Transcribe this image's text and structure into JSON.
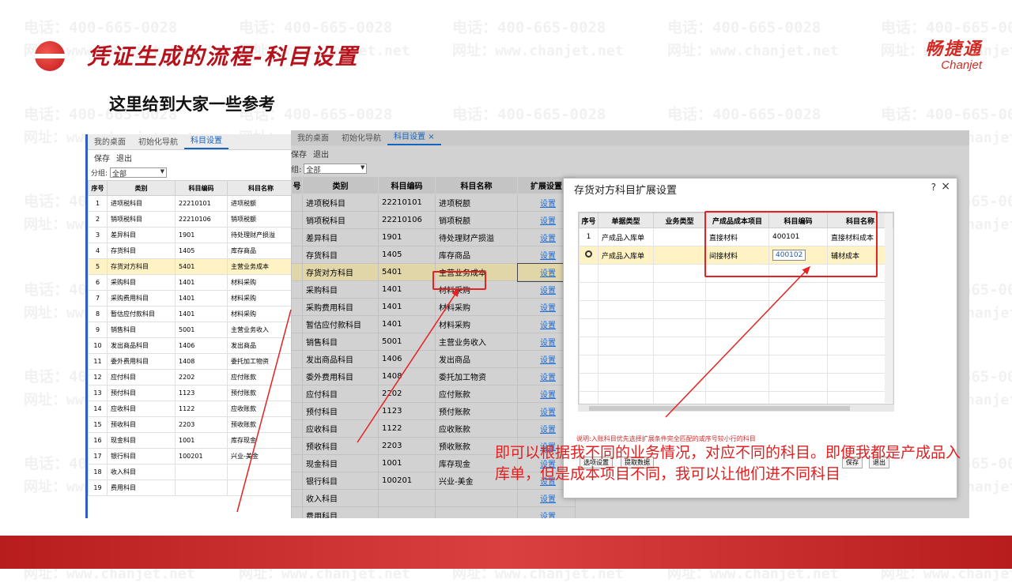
{
  "watermark": {
    "phone": "电话：400-665-0028",
    "site": "网址：www.chanjet.net"
  },
  "slide": {
    "title": "凭证生成的流程-科目设置",
    "subtitle": "这里给到大家一些参考"
  },
  "brand": {
    "cn": "畅捷通",
    "en": "Chanjet"
  },
  "app": {
    "tabs": [
      "我的桌面",
      "初始化导航",
      "科目设置"
    ],
    "close_glyph": "×",
    "toolbar": {
      "save": "保存",
      "exit": "退出"
    },
    "filter": {
      "label": "分组:",
      "value": "全部"
    },
    "columns": [
      "序号",
      "类别",
      "科目编码",
      "科目名称",
      "扩展设置"
    ],
    "link_text": "设置",
    "rows": [
      [
        "1",
        "进项税科目",
        "22210101",
        "进项税额"
      ],
      [
        "2",
        "销项税科目",
        "22210106",
        "销项税额"
      ],
      [
        "3",
        "差异科目",
        "1901",
        "待处理财产损溢"
      ],
      [
        "4",
        "存货科目",
        "1405",
        "库存商品"
      ],
      [
        "5",
        "存货对方科目",
        "5401",
        "主营业务成本"
      ],
      [
        "6",
        "采购科目",
        "1401",
        "材料采购"
      ],
      [
        "7",
        "采购费用科目",
        "1401",
        "材料采购"
      ],
      [
        "8",
        "暂估应付款科目",
        "1401",
        "材料采购"
      ],
      [
        "9",
        "销售科目",
        "5001",
        "主营业务收入"
      ],
      [
        "10",
        "发出商品科目",
        "1406",
        "发出商品"
      ],
      [
        "11",
        "委外费用科目",
        "1408",
        "委托加工物资"
      ],
      [
        "12",
        "应付科目",
        "2202",
        "应付账款"
      ],
      [
        "13",
        "预付科目",
        "1123",
        "预付账款"
      ],
      [
        "14",
        "应收科目",
        "1122",
        "应收账款"
      ],
      [
        "15",
        "预收科目",
        "2203",
        "预收账款"
      ],
      [
        "16",
        "现金科目",
        "1001",
        "库存现金"
      ],
      [
        "17",
        "银行科目",
        "100201",
        "兴业-美金"
      ],
      [
        "18",
        "收入科目",
        "",
        ""
      ],
      [
        "19",
        "费用科目",
        "",
        ""
      ]
    ],
    "highlight_row": 5
  },
  "dialog": {
    "title": "存货对方科目扩展设置",
    "help_glyph": "?",
    "close_glyph": "×",
    "columns": [
      "序号",
      "单据类型",
      "业务类型",
      "产成品成本项目",
      "科目编码",
      "科目名称"
    ],
    "rows": [
      [
        "1",
        "产成品入库单",
        "",
        "直接材料",
        "400101",
        "直接材料成本"
      ],
      [
        "",
        "产成品入库单",
        "",
        "间接材料",
        "400102",
        "辅材成本"
      ]
    ],
    "note": "说明:入账科目优先选择扩展条件完全匹配的或序号较小行的科目",
    "buttons": {
      "options": "选项设置",
      "fetch": "提取数据",
      "save": "保存",
      "exit": "退出"
    }
  },
  "caption": "即可以根据我不同的业务情况，对应不同的科目。即便我都是产成品入库单，但是成本项目不同，我可以让他们进不同科目",
  "colors": {
    "accent_red": "#e52222",
    "brand_red": "#b5121b",
    "link_blue": "#1f6fd6",
    "highlight": "#fff3c6"
  }
}
